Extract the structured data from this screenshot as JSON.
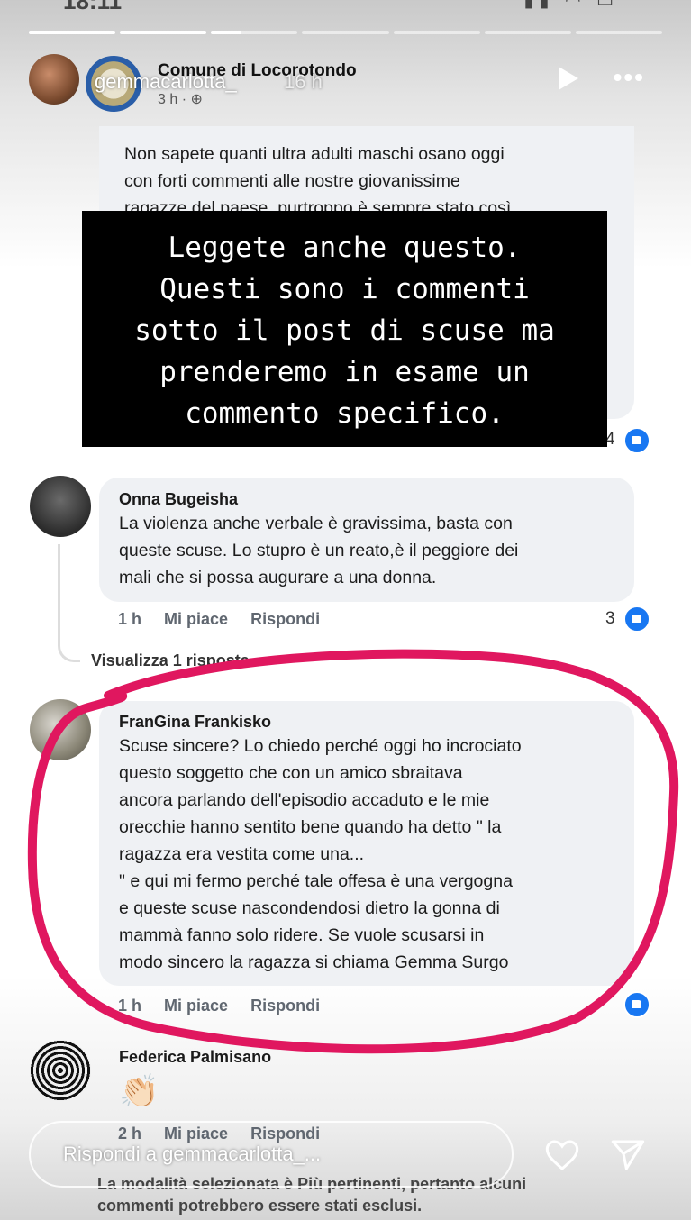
{
  "status_bar": {
    "time": "18:11",
    "icons": "▮▮ ◠ ▭"
  },
  "story": {
    "progress_fill": [
      1,
      1,
      0.35,
      0,
      0,
      0,
      0
    ]
  },
  "instagram": {
    "username": "gemmacarlotta_",
    "age": "16 h",
    "reply_placeholder": "Rispondi a gemmacarlotta_...",
    "icons": {
      "play": "play-icon",
      "more": "more-icon",
      "heart": "heart-icon",
      "send": "send-icon"
    }
  },
  "facebook_post": {
    "page_name": "Comune di Locorotondo",
    "time": "3 h · ⊕",
    "post_text": "Non sapete quanti ultra adulti maschi osano oggi\ncon forti commenti alle nostre giovanissime\nragazze del paese, purtroppo è sempre stato così"
  },
  "overlay_text": "Leggete anche questo.\nQuesti sono i commenti\nsotto il post di scuse ma\nprenderemo in esame un\ncommento specifico.",
  "first_comment": {
    "likes": "4"
  },
  "comments": [
    {
      "author": "Onna Bugeisha",
      "text": "La violenza anche verbale è gravissima, basta con\nqueste scuse. Lo stupro è un reato,è il peggiore dei\nmali che si possa augurare a una donna.",
      "time": "1 h",
      "like_label": "Mi piace",
      "reply_label": "Rispondi",
      "likes": "3",
      "view_replies": "Visualizza 1 risposta..."
    },
    {
      "author": "FranGina Frankisko",
      "text": "Scuse sincere? Lo chiedo perché oggi ho incrociato\nquesto soggetto   che con un amico sbraitava\nancora parlando dell'episodio accaduto e le mie\norecchie hanno sentito bene quando ha detto \" la\nragazza era vestita come una...\n\" e qui mi fermo perché tale offesa è una vergogna\ne queste scuse nascondendosi dietro la gonna di\nmammà fanno solo ridere. Se vuole scusarsi in\nmodo sincero  la ragazza  si chiama Gemma Surgo",
      "time": "1 h",
      "like_label": "Mi piace",
      "reply_label": "Rispondi"
    },
    {
      "author": "Federica Palmisano",
      "emoji": "👏🏻",
      "time": "2 h",
      "like_label": "Mi piace",
      "reply_label": "Rispondi"
    }
  ],
  "footer_note": "La modalità selezionata è Più pertinenti, pertanto alcuni\ncommenti potrebbero essere stati esclusi.",
  "colors": {
    "annotation": "#e0175f",
    "like_blue": "#1877f2",
    "bubble": "#eff1f4"
  }
}
